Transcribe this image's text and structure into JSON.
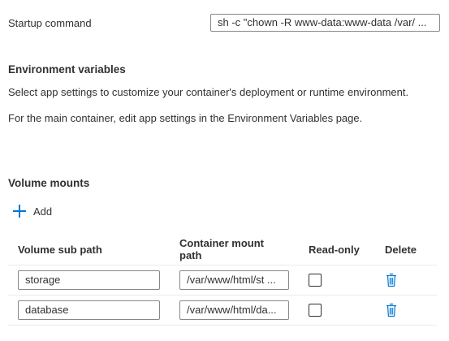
{
  "startup": {
    "label": "Startup command",
    "value": "sh -c \"chown -R www-data:www-data /var/ ..."
  },
  "env": {
    "title": "Environment variables",
    "line1": "Select app settings to customize your container's deployment or runtime environment.",
    "line2": "For the main container, edit app settings in the Environment Variables page."
  },
  "volumes": {
    "title": "Volume mounts",
    "add_label": "Add",
    "columns": [
      "Volume sub path",
      "Container mount path",
      "Read-only",
      "Delete"
    ],
    "rows": [
      {
        "sub_path": "storage",
        "mount_path": "/var/www/html/st ..."
      },
      {
        "sub_path": "database",
        "mount_path": "/var/www/html/da..."
      }
    ]
  },
  "colors": {
    "accent": "#0078d4",
    "text": "#323130",
    "border": "#8a8886"
  },
  "icons": {
    "add": "plus-icon",
    "delete": "trash-icon"
  }
}
